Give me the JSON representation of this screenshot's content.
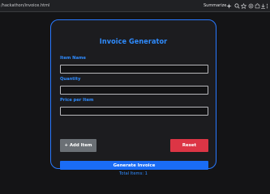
{
  "browser": {
    "url": "/hackathon/invoice.html",
    "summarize_label": "Summarize",
    "icons": [
      "sparkle-icon",
      "search-icon",
      "star-icon",
      "extensions-icon",
      "puzzle-icon",
      "download-icon",
      "menu-icon"
    ]
  },
  "form": {
    "title": "Invoice Generator",
    "fields": [
      {
        "label": "Item Name",
        "value": "",
        "placeholder": ""
      },
      {
        "label": "Quantity",
        "value": "",
        "placeholder": ""
      },
      {
        "label": "Price per Item",
        "value": "",
        "placeholder": ""
      }
    ],
    "add_item_label": "+ Add Item",
    "reset_label": "Reset",
    "generate_label": "Generate Invoice",
    "total_items_text": "Total Items: 1"
  },
  "colors": {
    "accent": "#2f8cff",
    "card_border": "#2979ff",
    "add_button": "#6b7075",
    "reset_button": "#dc3545",
    "generate_button": "#1a6cf5",
    "background": "#141416"
  }
}
